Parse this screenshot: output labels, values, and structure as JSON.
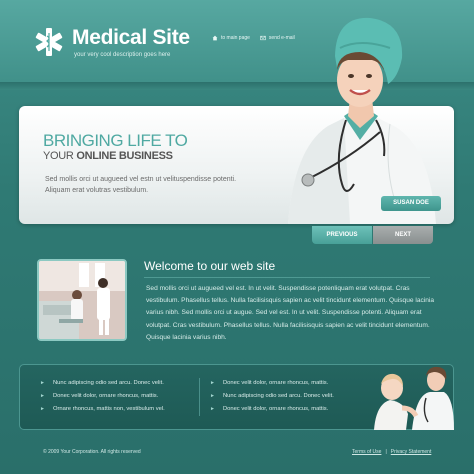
{
  "header": {
    "title": "Medical Site",
    "tagline": "your very cool description goes here",
    "links": [
      {
        "label": "to main page",
        "icon": "home-icon"
      },
      {
        "label": "send e-mail",
        "icon": "mail-icon"
      }
    ]
  },
  "hero": {
    "heading_line1": "BRINGING LIFE TO",
    "heading_line2_light": "YOUR ",
    "heading_line2_bold": "ONLINE BUSINESS",
    "text": "Sed mollis orci ut augueed vel estn ut velituspendisse potenti. Aliquam erat volutras vestibulum.",
    "name_badge": "SUSAN DOE",
    "prev_label": "PREVIOUS",
    "next_label": "NEXT"
  },
  "welcome": {
    "title": "Welcome to our web site",
    "text": "Sed mollis orci ut augueed vel est. In ut velit. Suspendisse potenliquam erat volutpat. Cras vestibulum. Phasellus tellus. Nulla facilisisquis sapien ac velit tincidunt elementum. Quisque lacinia varius nibh. Sed mollis orci ut augue. Sed vel est. In ut velit. Suspendisse potenti. Aliquam erat volutpat. Cras vestibulum. Phasellus tellus. Nulla facilisisquis sapien ac velit tincidunt elementum. Quisque lacinia varius nibh."
  },
  "bottom_lists": {
    "left": [
      "Nunc adipiscing odio sed arcu. Donec velit.",
      "Donec velit dolor, ornare rhoncus, mattis.",
      "Ornare rhoncus, mattis non, vestibulum vel."
    ],
    "right": [
      "Donec velit dolor, ornare rhoncus, mattis.",
      "Nunc adipiscing odio sed arcu. Donec velit.",
      "Donec velit dolor, ornare rhoncus, mattis."
    ]
  },
  "footer": {
    "copyright": "© 2009 Your Corporation. All rights reserved",
    "terms": "Terms of Use",
    "separator": "|",
    "privacy": "Privacy Statement"
  },
  "colors": {
    "accent": "#4fa9a2",
    "background": "#2f7a74"
  }
}
